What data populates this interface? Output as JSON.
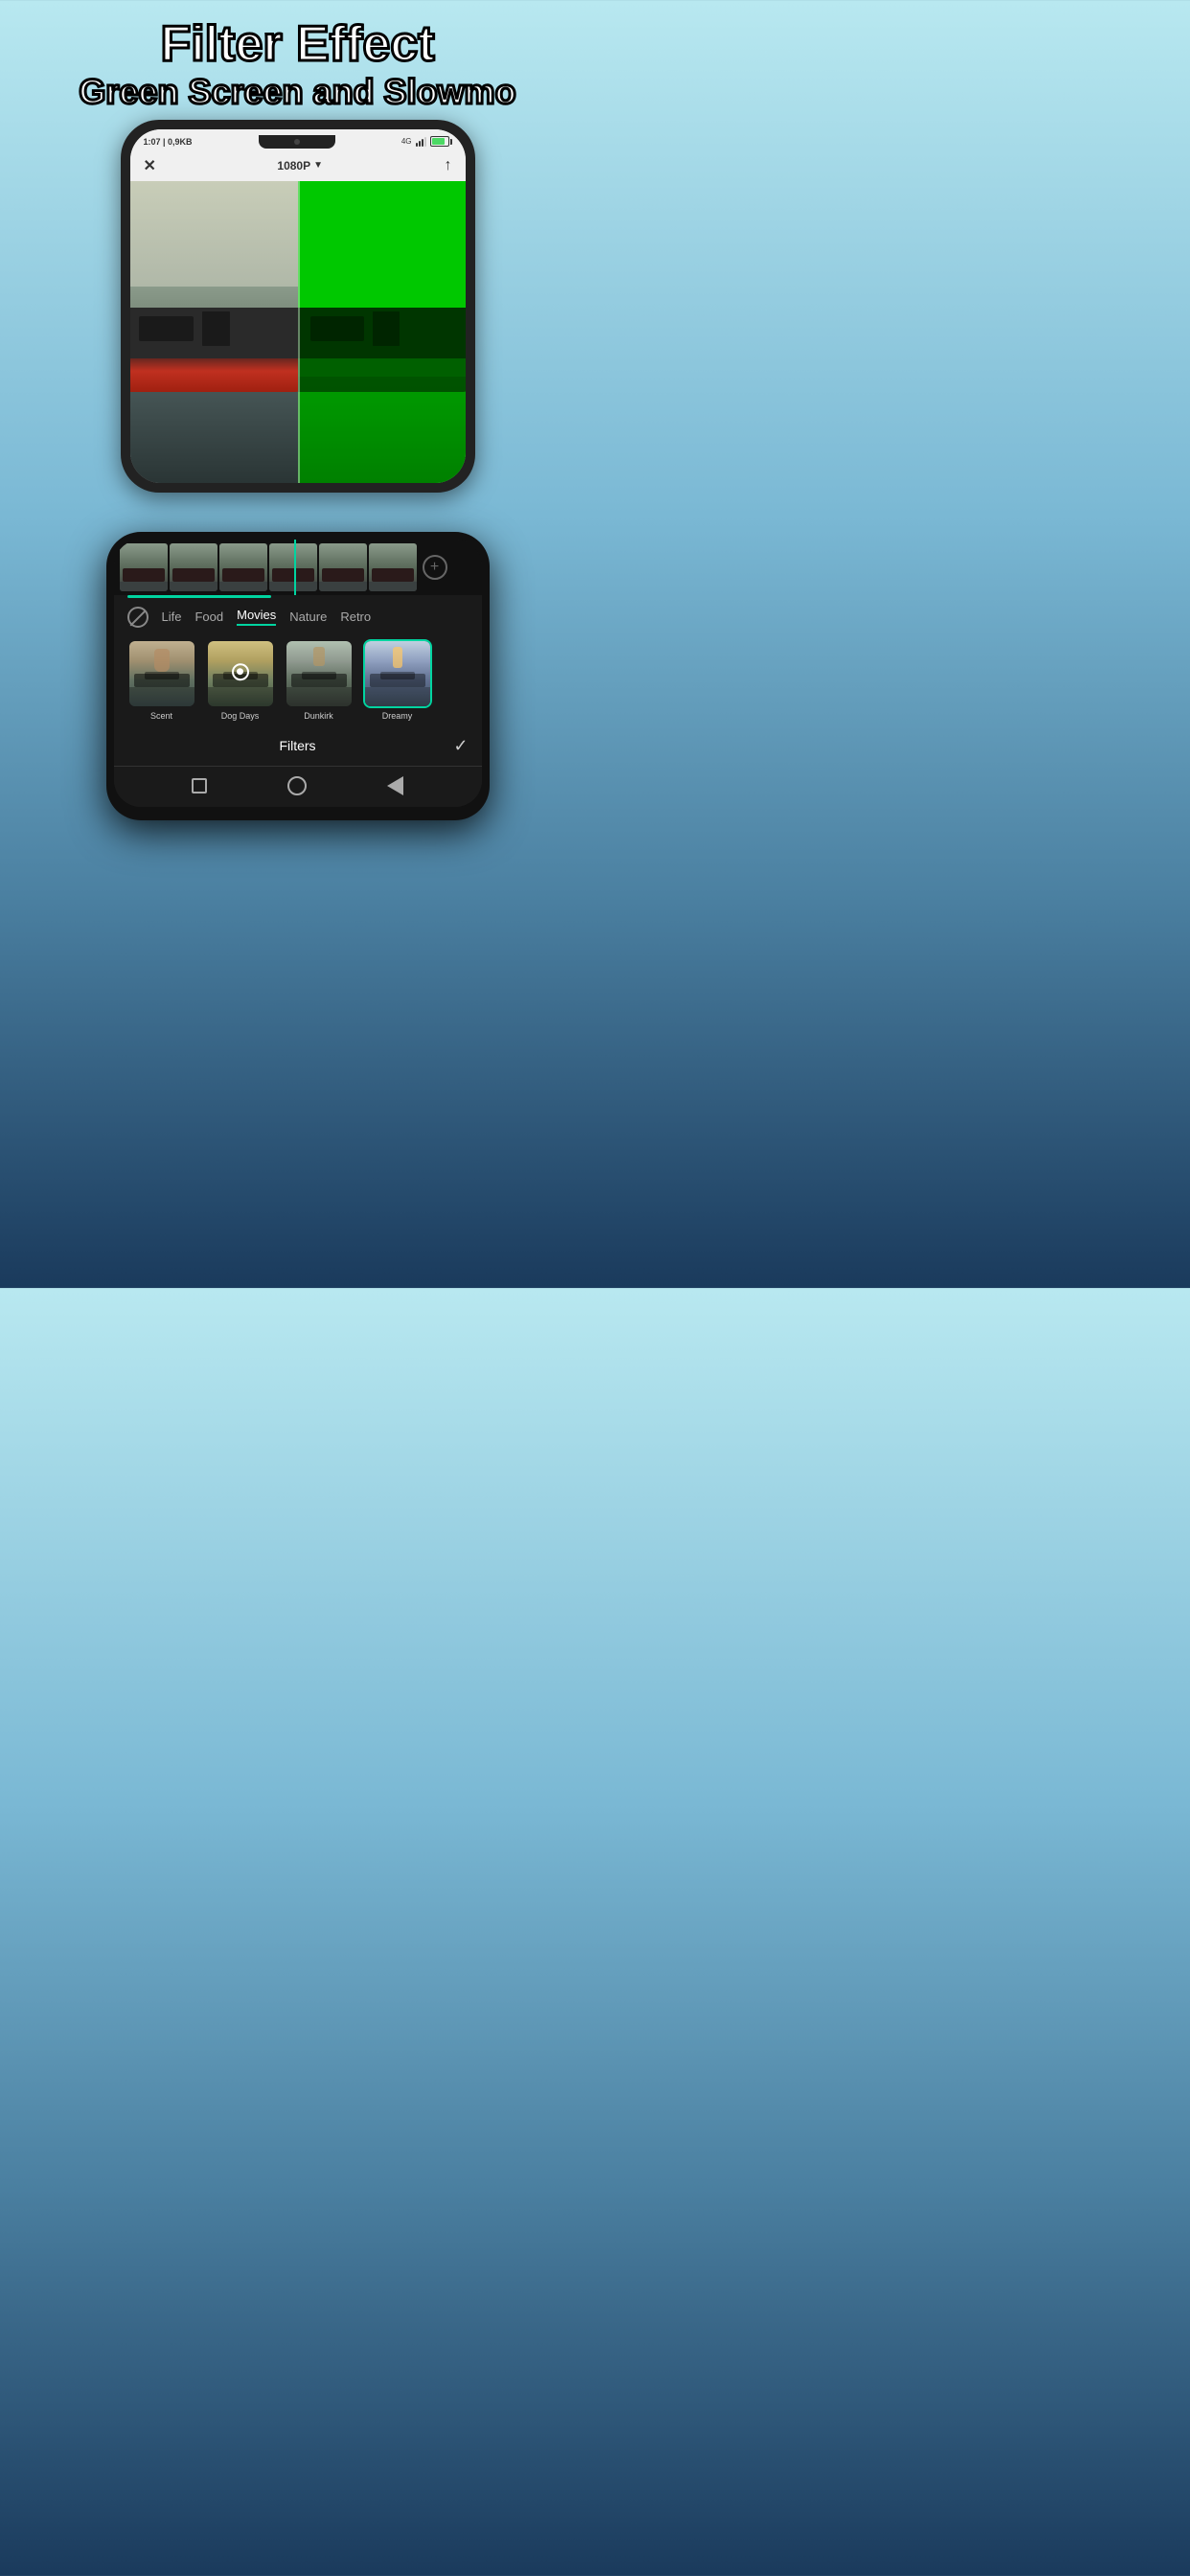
{
  "headline": {
    "line1": "Filter Effect",
    "line2": "Green Screen and Slowmo"
  },
  "top_phone": {
    "status_bar": {
      "time": "1:07 | 0,9KB",
      "network": "4G",
      "battery": "89%"
    },
    "toolbar": {
      "close_label": "✕",
      "resolution": "1080P",
      "resolution_arrow": "▼",
      "export_icon": "↑"
    }
  },
  "filter_section": {
    "tabs": [
      {
        "label": "Life",
        "active": false
      },
      {
        "label": "Food",
        "active": false
      },
      {
        "label": "Movies",
        "active": true
      },
      {
        "label": "Nature",
        "active": false
      },
      {
        "label": "Retro",
        "active": false
      }
    ],
    "swatches": [
      {
        "label": "Scent",
        "selected": false
      },
      {
        "label": "Dog Days",
        "selected": false
      },
      {
        "label": "Dunkirk",
        "selected": false
      },
      {
        "label": "Dreamy",
        "selected": true
      }
    ],
    "bottom_label": "Filters",
    "check_icon": "✓"
  },
  "bottom_nav": {
    "square": "",
    "circle": "",
    "triangle": ""
  }
}
